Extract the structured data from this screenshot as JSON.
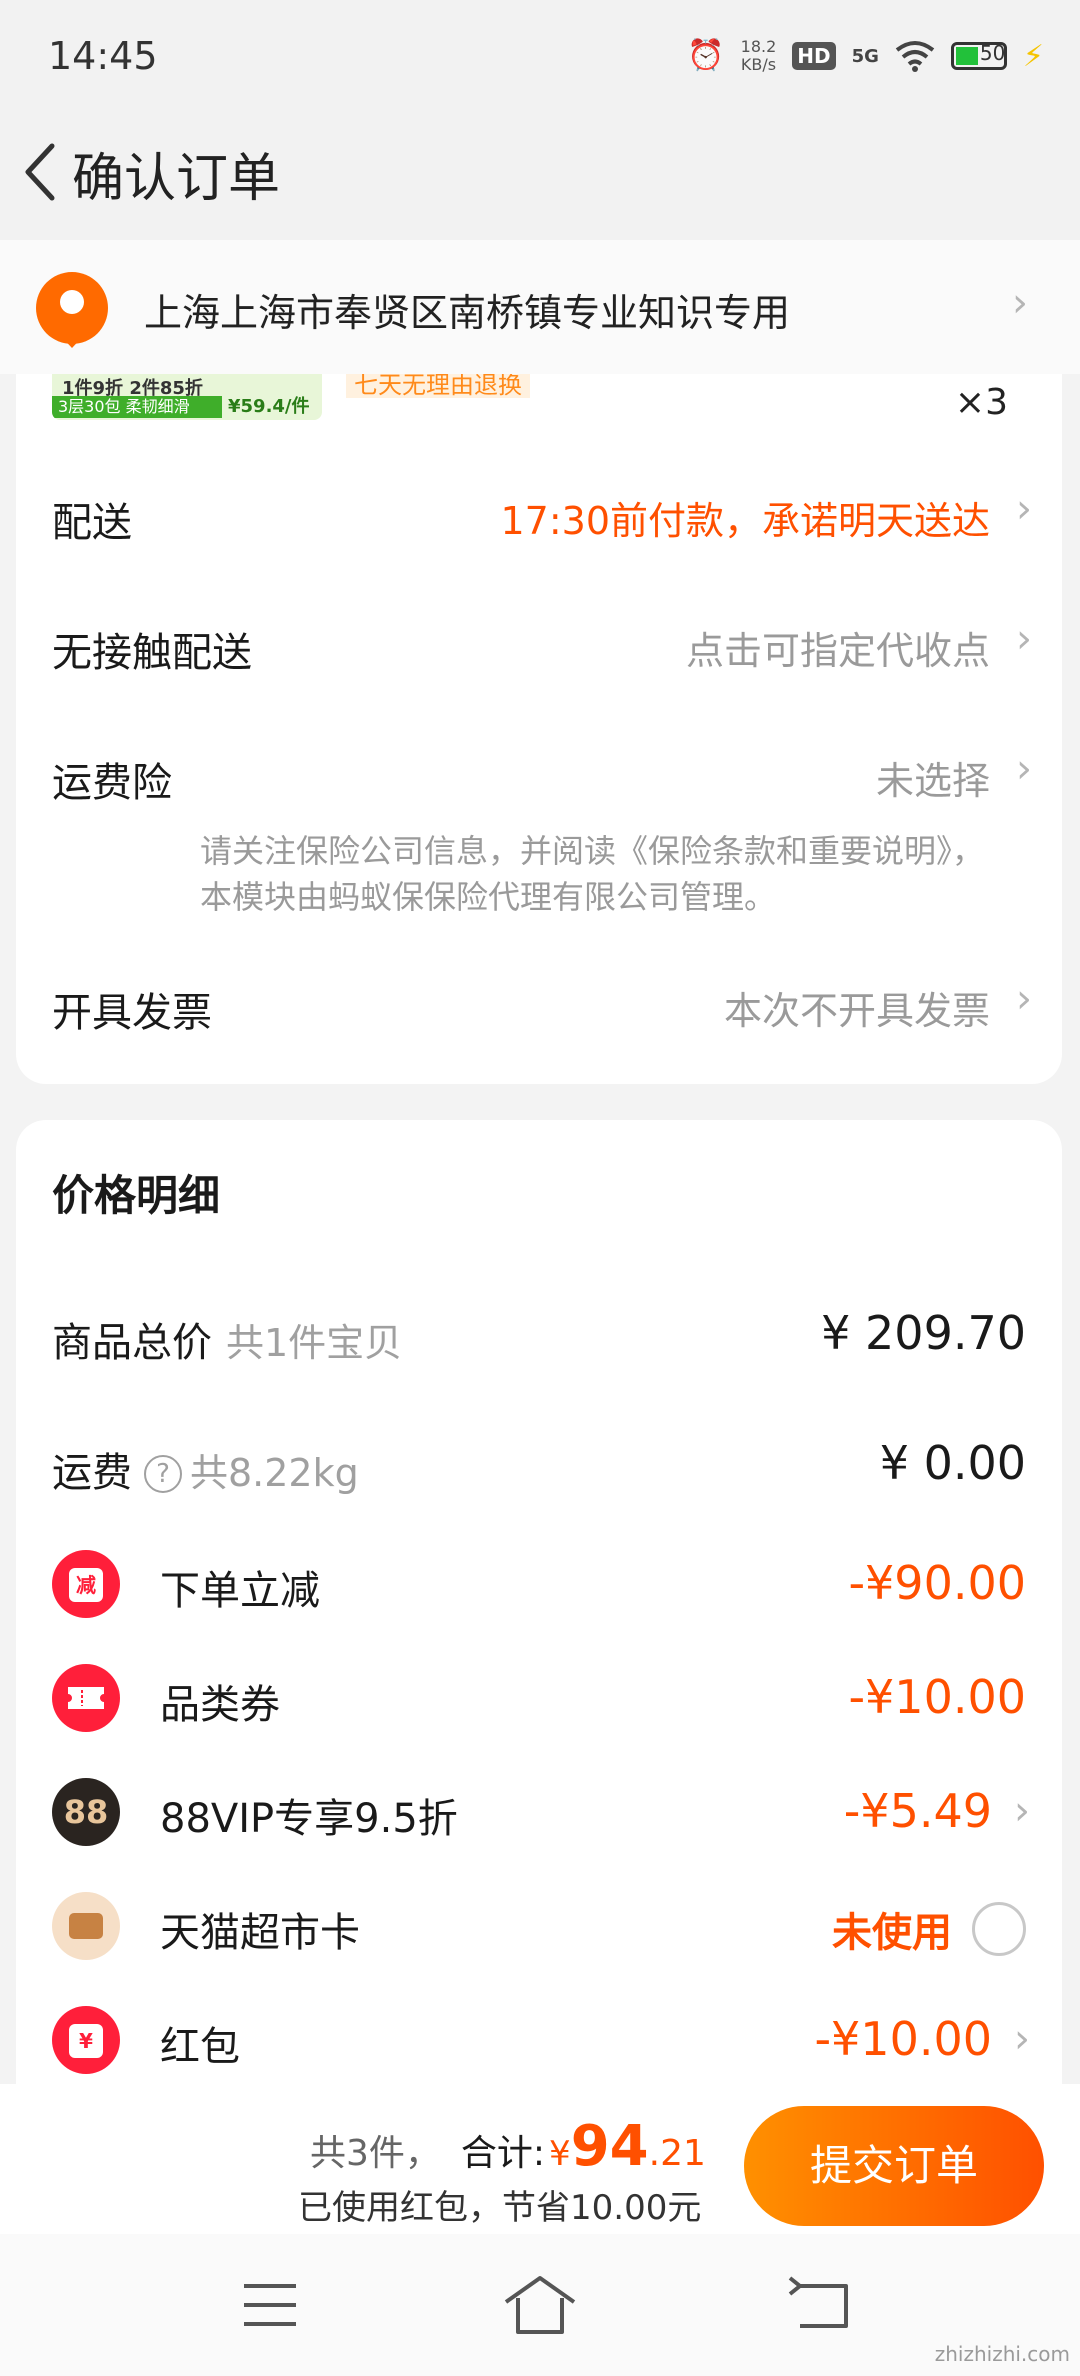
{
  "status_bar": {
    "time": "14:45",
    "net_speed_value": "18.2",
    "net_speed_unit": "KB/s",
    "hd": "HD",
    "network": "5G",
    "battery": "50"
  },
  "header": {
    "title": "确认订单"
  },
  "address": {
    "text": "上海上海市奉贤区南桥镇专业知识专用"
  },
  "product": {
    "promo_line1": "1件9折  2件85折",
    "promo_line2": "3层30包 柔韧细滑",
    "promo_price": "¥59.4/件",
    "tag": "七天无理由退换",
    "quantity": "×3"
  },
  "order_options": {
    "delivery": {
      "label": "配送",
      "value": "17:30前付款，承诺明天送达"
    },
    "contactless": {
      "label": "无接触配送",
      "value": "点击可指定代收点"
    },
    "shipping_insurance": {
      "label": "运费险",
      "value": "未选择",
      "note": "请关注保险公司信息，并阅读《保险条款和重要说明》，本模块由蚂蚁保保险代理有限公司管理。"
    },
    "invoice": {
      "label": "开具发票",
      "value": "本次不开具发票"
    }
  },
  "price_details": {
    "title": "价格明细",
    "goods_total": {
      "label": "商品总价",
      "sub": "共1件宝贝",
      "amount": "¥ 209.70"
    },
    "shipping": {
      "label": "运费",
      "sub": "共8.22kg",
      "amount": "¥ 0.00"
    },
    "order_discount": {
      "label": "下单立减",
      "badge": "减",
      "amount": "-¥90.00"
    },
    "category_coupon": {
      "label": "品类券",
      "amount": "-¥10.00"
    },
    "vip": {
      "label": "88VIP专享9.5折",
      "badge": "88",
      "amount": "-¥5.49"
    },
    "tmall_card": {
      "label": "天猫超市卡",
      "status": "未使用"
    },
    "red_packet": {
      "label": "红包",
      "badge": "¥",
      "amount": "-¥10.00"
    }
  },
  "summary": {
    "count": "共3件，",
    "total_label": "合计:",
    "currency": "¥",
    "total_int": "94",
    "total_dec": ".21",
    "saving": "已使用红包，节省10.00元",
    "submit": "提交订单"
  },
  "watermark": "zhizhizhi.com",
  "colors": {
    "accent": "#ff5000",
    "gradient_start": "#ff9000",
    "background": "#f3f3f3"
  }
}
